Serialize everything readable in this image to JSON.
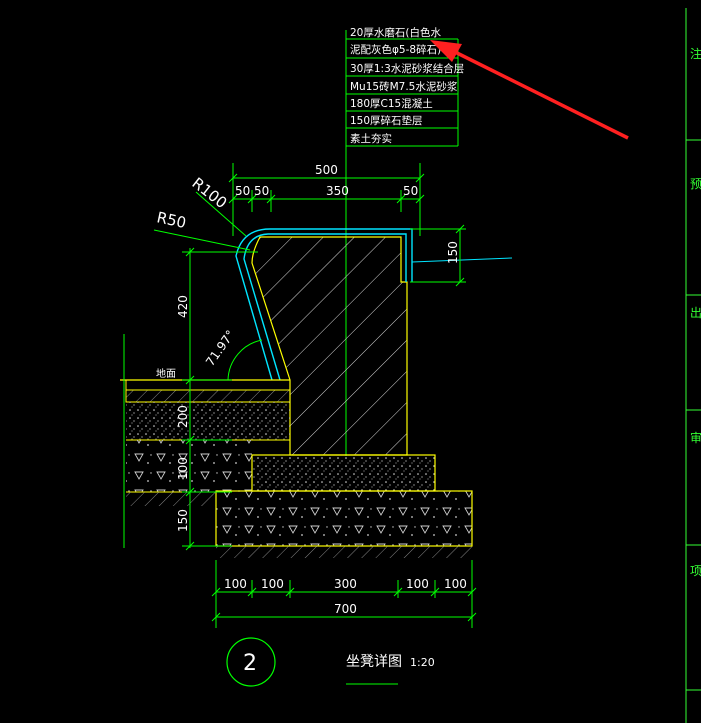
{
  "layers": [
    "20厚水磨石(白色水",
    "泥配灰色φ5-8碎石)",
    "30厚1:3水泥砂浆结合层",
    "Mu15砖M7.5水泥砂浆",
    "180厚C15混凝土",
    "150厚碎石垫层",
    "素土夯实"
  ],
  "dimensions": {
    "top_total": "500",
    "top_parts": [
      "50",
      "50",
      "350",
      "50"
    ],
    "bottom_total": "700",
    "bottom_parts": [
      "100",
      "100",
      "300",
      "100",
      "100"
    ],
    "left_420": "420",
    "left_200": "200",
    "left_100": "100",
    "left_150": "150",
    "right_150": "150",
    "radius_large": "R100",
    "radius_small": "R50",
    "angle": "71.97°"
  },
  "ground_label": "地面",
  "detail": {
    "number": "2",
    "title": "坐凳详图",
    "scale": "1:20"
  },
  "right_panel_labels": [
    "注",
    "预",
    "出",
    "审",
    "项"
  ],
  "colors": {
    "background": "#000000",
    "outline": "#ffff00",
    "dim_line": "#00ff00",
    "finish": "#00ffff",
    "arrow": "#ff2020",
    "text": "#ffffff"
  }
}
